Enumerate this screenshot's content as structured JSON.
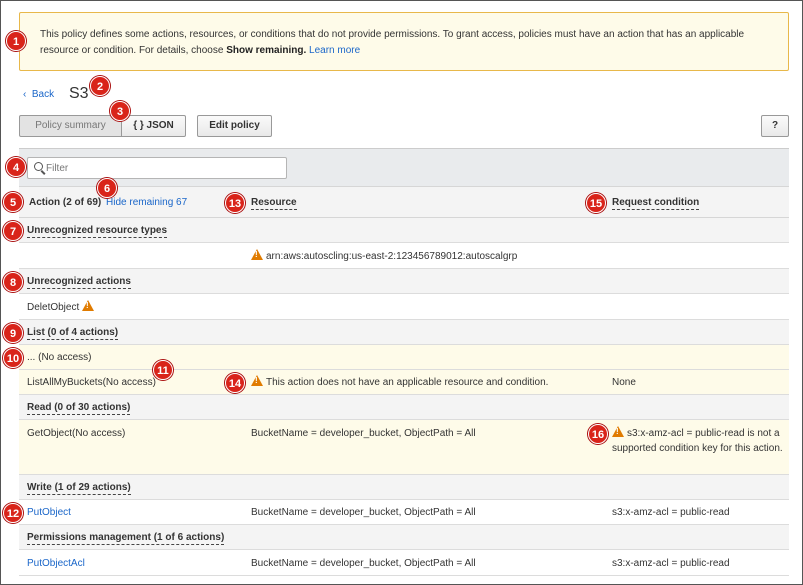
{
  "banner": {
    "text_part1": "This policy defines some actions, resources, or conditions that do not provide permissions. To grant access, policies must have an action that has an applicable resource or condition. For details, choose ",
    "show_remaining": "Show remaining.",
    "learn_more": "Learn more"
  },
  "nav": {
    "back_label": "Back",
    "page_title": "S3"
  },
  "toolbar": {
    "policy_summary": "Policy summary",
    "json": "{ } JSON",
    "edit_policy": "Edit policy",
    "help": "?"
  },
  "filter": {
    "placeholder": "Filter"
  },
  "table": {
    "headers": {
      "action": "Action (2 of 69)",
      "hide_remaining": "Hide remaining 67",
      "resource": "Resource",
      "request_condition": "Request condition"
    },
    "rows": {
      "unrec_res_types": "Unrecognized resource types",
      "arn": "arn:aws:autoscling:us-east-2:123456789012:autoscalgrp",
      "unrec_actions": "Unrecognized actions",
      "delet_object": "DeletObject",
      "list_group": "List (0 of 4 actions)",
      "no_access": "... (No access)",
      "list_all": "ListAllMyBuckets(No access)",
      "list_all_resource": "This action does not have an applicable resource and condition.",
      "list_all_condition": "None",
      "read_group": "Read (0 of 30 actions)",
      "get_object": "GetObject(No access)",
      "get_object_resource": "BucketName = developer_bucket, ObjectPath = All",
      "get_object_condition": "s3:x-amz-acl = public-read is not a supported condition key for this action.",
      "write_group": "Write (1 of 29 actions)",
      "put_object": "PutObject",
      "put_object_resource": "BucketName = developer_bucket, ObjectPath = All",
      "put_object_condition": "s3:x-amz-acl = public-read",
      "perm_group": "Permissions management (1 of 6 actions)",
      "put_object_acl": "PutObjectAcl",
      "put_object_acl_resource": "BucketName = developer_bucket, ObjectPath = All",
      "put_object_acl_condition": "s3:x-amz-acl = public-read"
    }
  },
  "callouts": [
    "1",
    "2",
    "3",
    "4",
    "5",
    "6",
    "7",
    "8",
    "9",
    "10",
    "11",
    "12",
    "13",
    "14",
    "15",
    "16"
  ],
  "colors": {
    "accent_link": "#1a66c9",
    "callout": "#d9241a",
    "warning": "#e07b00",
    "banner_border": "#e8b84a"
  }
}
